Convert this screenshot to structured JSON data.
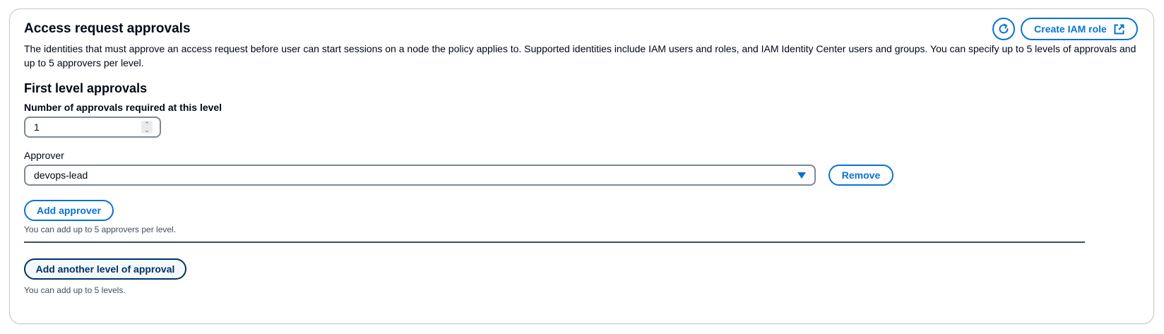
{
  "panel": {
    "title": "Access request approvals",
    "description": "The identities that must approve an access request before user can start sessions on a node the policy applies to. Supported identities include IAM users and roles, and IAM Identity Center users and groups. You can specify up to 5 levels of approvals and up to 5 approvers per level.",
    "refresh_icon": "refresh-icon",
    "create_role_label": "Create IAM role",
    "external_link_icon": "external-link-icon"
  },
  "level": {
    "title": "First level approvals",
    "approvals_label": "Number of approvals required at this level",
    "approvals_value": "1",
    "approver_label": "Approver",
    "approver_value": "devops-lead",
    "remove_label": "Remove",
    "add_approver_label": "Add approver",
    "approver_hint": "You can add up to 5 approvers per level."
  },
  "footer": {
    "add_level_label": "Add another level of approval",
    "level_hint": "You can add up to 5 levels."
  },
  "colors": {
    "accent": "#0972d3",
    "dark_accent": "#033160",
    "text": "#000716",
    "border": "#7d8998"
  }
}
